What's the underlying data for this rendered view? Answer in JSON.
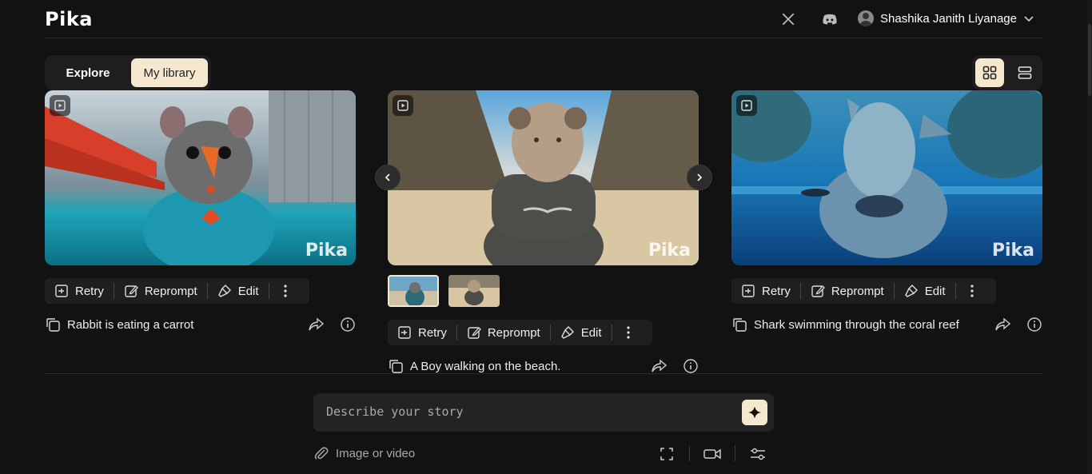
{
  "app": {
    "logo": "Pika"
  },
  "header": {
    "icons": [
      "x-twitter-icon",
      "discord-icon"
    ],
    "user_name": "Shashika Janith Liyanage"
  },
  "tabs": {
    "explore": "Explore",
    "library": "My library",
    "active": "My library"
  },
  "view_toggle": {
    "active": "grid"
  },
  "cards": [
    {
      "caption": "Rabbit is eating a carrot",
      "watermark": "Pika",
      "actions": {
        "retry": "Retry",
        "reprompt": "Reprompt",
        "edit": "Edit"
      }
    },
    {
      "caption": "A Boy walking on the beach.",
      "watermark": "Pika",
      "actions": {
        "retry": "Retry",
        "reprompt": "Reprompt",
        "edit": "Edit"
      },
      "variants": 2,
      "selected_variant": 1
    },
    {
      "caption": "Shark swimming through the coral reef",
      "watermark": "Pika",
      "actions": {
        "retry": "Retry",
        "reprompt": "Reprompt",
        "edit": "Edit"
      }
    }
  ],
  "prompt": {
    "placeholder": "Describe your story",
    "value": "",
    "attach_label": "Image or video"
  },
  "colors": {
    "accent": "#f6e7cf",
    "background": "#121212",
    "panel": "#1f1f1f"
  }
}
